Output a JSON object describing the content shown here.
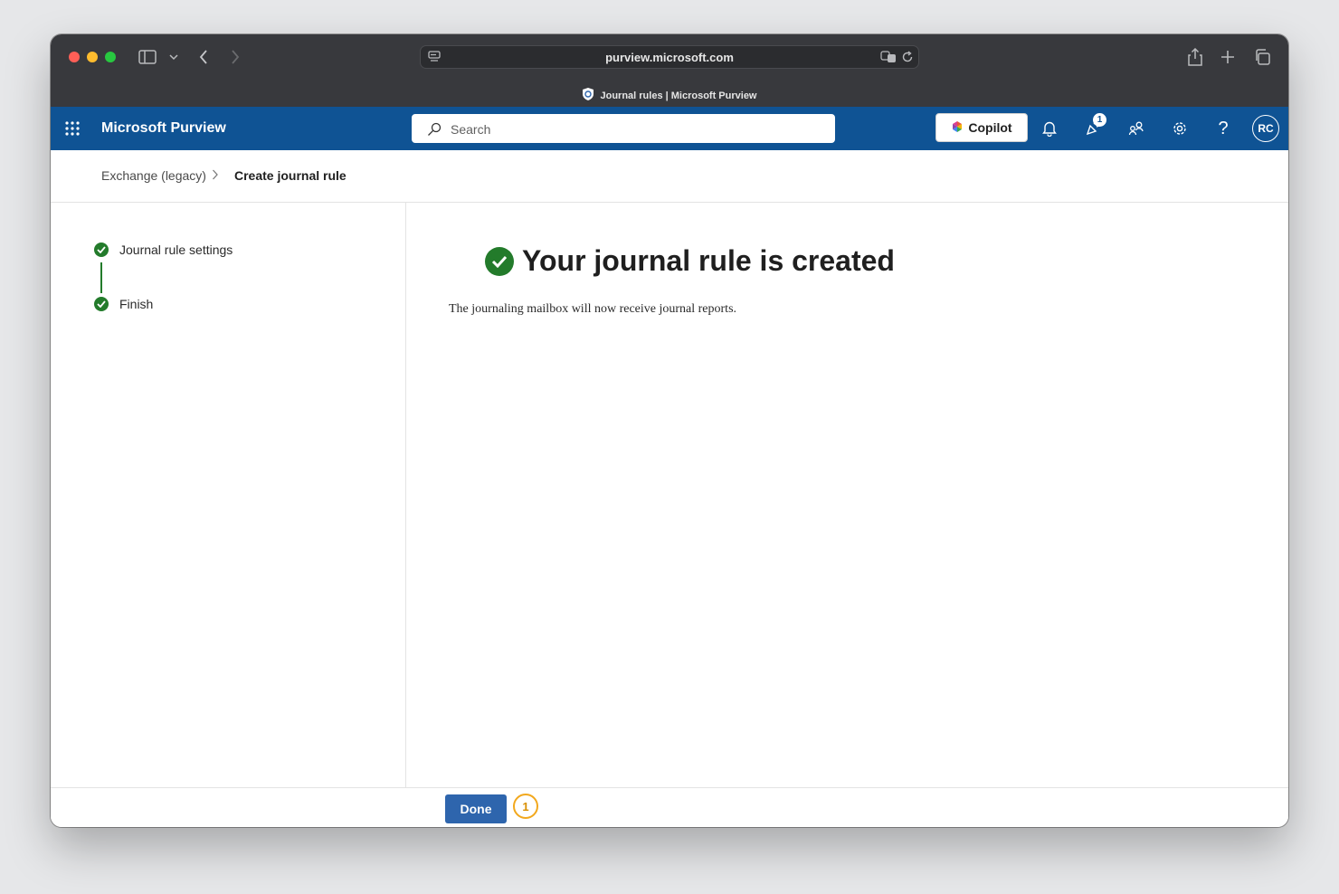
{
  "browser": {
    "url": "purview.microsoft.com",
    "tab_title": "Journal rules | Microsoft Purview"
  },
  "appbar": {
    "brand": "Microsoft Purview",
    "search_placeholder": "Search",
    "copilot_label": "Copilot",
    "notification_count": "1",
    "avatar_initials": "RC",
    "help_label": "?"
  },
  "breadcrumb": {
    "parent": "Exchange (legacy)",
    "current": "Create journal rule"
  },
  "steps": [
    {
      "label": "Journal rule settings",
      "status": "complete"
    },
    {
      "label": "Finish",
      "status": "complete"
    }
  ],
  "main": {
    "title": "Your journal rule is created",
    "description": "The journaling mailbox will now receive journal reports."
  },
  "footer": {
    "done_label": "Done",
    "marker_label": "1"
  },
  "colors": {
    "appbar": "#0f5394",
    "success": "#237b2b",
    "primary_button": "#2e65ad",
    "marker": "#f2a81d"
  }
}
